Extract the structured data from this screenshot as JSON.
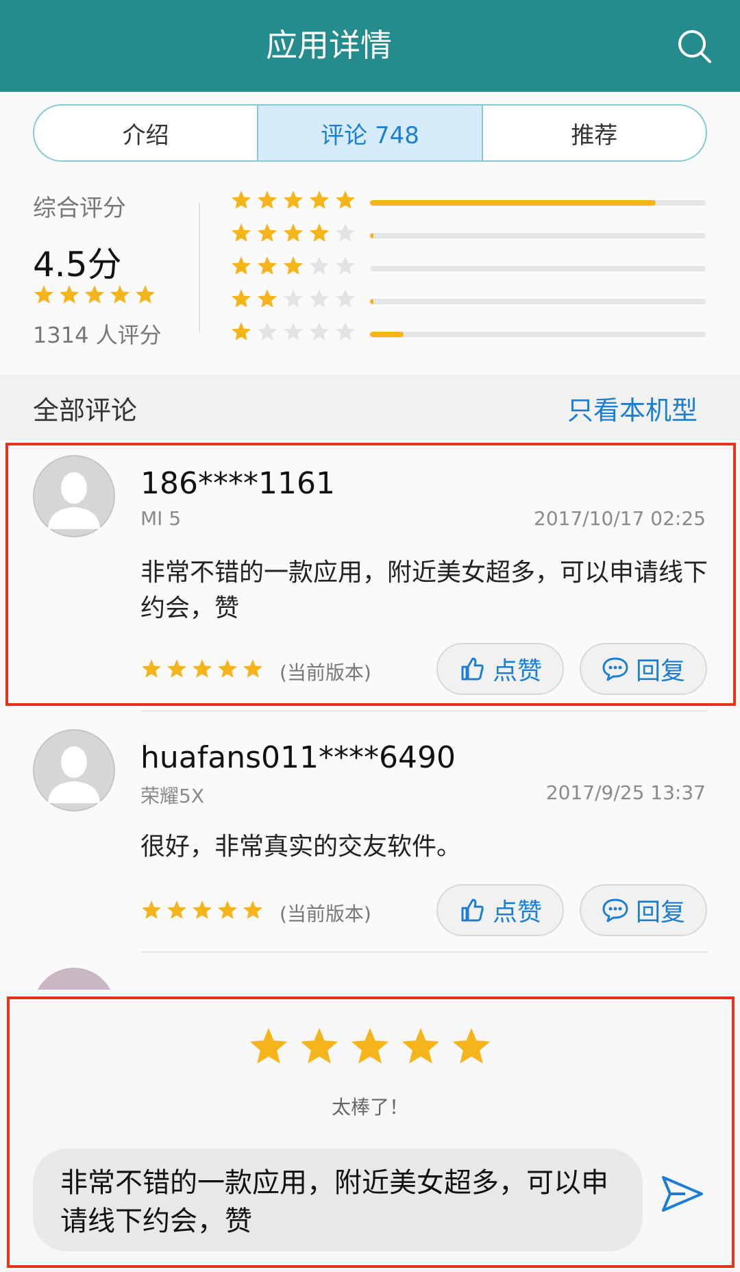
{
  "header": {
    "title": "应用详情"
  },
  "tabs": [
    {
      "label": "介绍",
      "active": false
    },
    {
      "label": "评论 748",
      "active": true
    },
    {
      "label": "推荐",
      "active": false
    }
  ],
  "summary": {
    "label": "综合评分",
    "score": "4.5分",
    "stars": 5,
    "count": "1314 人评分",
    "distribution": [
      {
        "stars": 5,
        "fraction": 0.85
      },
      {
        "stars": 4,
        "fraction": 0.01
      },
      {
        "stars": 3,
        "fraction": 0.0
      },
      {
        "stars": 2,
        "fraction": 0.01
      },
      {
        "stars": 1,
        "fraction": 0.1
      }
    ]
  },
  "section": {
    "title": "全部评论",
    "filter_link": "只看本机型"
  },
  "reviews": [
    {
      "user": "186****1161",
      "device": "MI 5",
      "date": "2017/10/17 02:25",
      "text": "非常不错的一款应用，附近美女超多，可以申请线下约会，赞",
      "stars": 5,
      "version": "(当前版本)",
      "like_label": "点赞",
      "reply_label": "回复"
    },
    {
      "user": "huafans011****6490",
      "device": "荣耀5X",
      "date": "2017/9/25 13:37",
      "text": "很好，非常真实的交友软件。",
      "stars": 5,
      "version": "(当前版本)",
      "like_label": "点赞",
      "reply_label": "回复"
    }
  ],
  "compose": {
    "stars": 5,
    "rating_label": "太棒了！",
    "text": "非常不错的一款应用，附近美女超多，可以申请线下约会，赞"
  },
  "colors": {
    "header": "#258c8e",
    "star": "#f4b41a",
    "accent": "#1a7fd4",
    "highlight": "#e8321e"
  }
}
